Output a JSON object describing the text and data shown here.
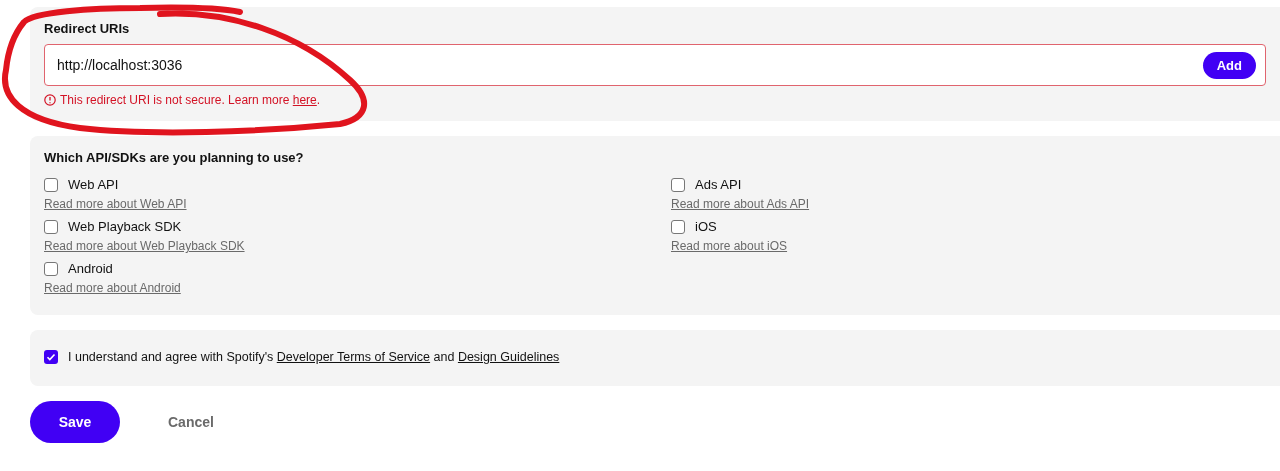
{
  "redirect": {
    "label": "Redirect URIs",
    "value": "http://localhost:3036",
    "add_button": "Add",
    "error": {
      "text": "This redirect URI is not secure. Learn more ",
      "link": "here",
      "end": "."
    }
  },
  "apis": {
    "question": "Which API/SDKs are you planning to use?",
    "options": [
      {
        "label": "Web API",
        "checked": false,
        "link": "Read more about Web API"
      },
      {
        "label": "Ads API",
        "checked": false,
        "link": "Read more about Ads API"
      },
      {
        "label": "Web Playback SDK",
        "checked": false,
        "link": "Read more about Web Playback SDK"
      },
      {
        "label": "iOS",
        "checked": false,
        "link": "Read more about iOS"
      },
      {
        "label": "Android",
        "checked": false,
        "link": "Read more about Android"
      }
    ]
  },
  "agreement": {
    "checked": true,
    "parts": [
      {
        "kind": "text",
        "text": "I understand and agree with Spotify's "
      },
      {
        "kind": "link",
        "text": "Developer Terms of Service"
      },
      {
        "kind": "text",
        "text": " and "
      },
      {
        "kind": "link",
        "text": "Design Guidelines"
      }
    ]
  },
  "actions": {
    "save": "Save",
    "cancel": "Cancel"
  }
}
